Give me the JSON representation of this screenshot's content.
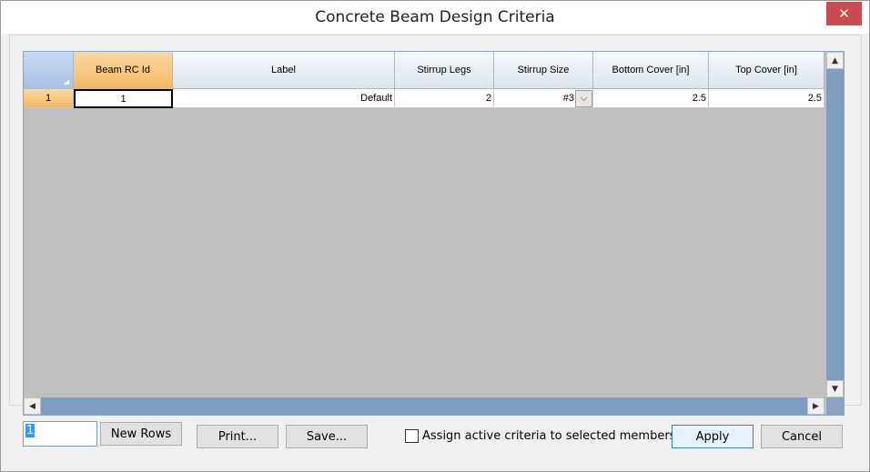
{
  "window": {
    "title": "Concrete Beam Design Criteria",
    "close_glyph": "✕"
  },
  "grid": {
    "columns": [
      {
        "label": ""
      },
      {
        "label": "Beam RC Id"
      },
      {
        "label": "Label"
      },
      {
        "label": "Stirrup Legs"
      },
      {
        "label": "Stirrup Size"
      },
      {
        "label": "Bottom Cover [in]"
      },
      {
        "label": "Top Cover [in]"
      }
    ],
    "rows": [
      {
        "row_number": "1",
        "beam_rc_id": "1",
        "label": "Default",
        "stirrup_legs": "2",
        "stirrup_size": "#3",
        "bottom_cover": "2.5",
        "top_cover": "2.5"
      }
    ],
    "scroll": {
      "up": "▲",
      "down": "▼",
      "left": "◀",
      "right": "▶",
      "combo": "⌵"
    }
  },
  "footer": {
    "new_rows_value": "1",
    "new_rows_button": "New Rows",
    "print_button": "Print...",
    "save_button": "Save...",
    "assign_checkbox_label": "Assign active criteria to selected members",
    "apply_button": "Apply",
    "cancel_button": "Cancel"
  }
}
